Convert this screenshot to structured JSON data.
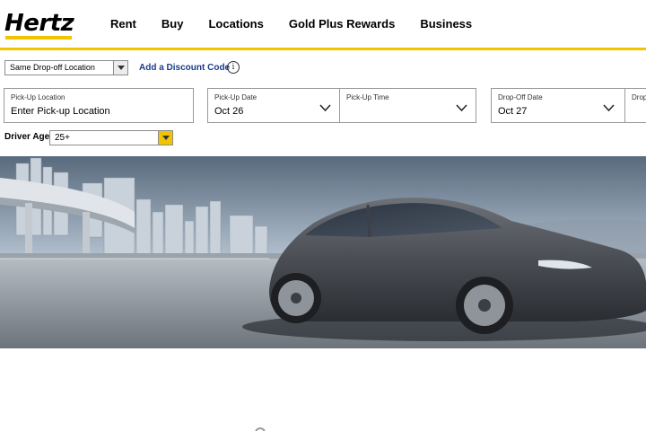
{
  "brand": {
    "logo_text": "Hertz",
    "accent": "#f2c400",
    "link_color": "#1a3c8b"
  },
  "nav": {
    "items": [
      {
        "label": "Rent"
      },
      {
        "label": "Buy"
      },
      {
        "label": "Locations"
      },
      {
        "label": "Gold Plus Rewards"
      },
      {
        "label": "Business"
      }
    ]
  },
  "booking": {
    "dropoff_mode": {
      "selected": "Same Drop-off Location"
    },
    "discount_link": "Add a Discount Code",
    "info_icon": "i",
    "pickup_location": {
      "label": "Pick-Up Location",
      "placeholder": "Enter Pick-up Location"
    },
    "pickup_date": {
      "label": "Pick-Up Date",
      "value": "Oct 26"
    },
    "pickup_time": {
      "label": "Pick-Up Time",
      "value": ""
    },
    "dropoff_date": {
      "label": "Drop-Off Date",
      "value": "Oct 27"
    },
    "dropoff_time": {
      "label": "Drop",
      "value": ""
    },
    "driver_age": {
      "label": "Driver Age",
      "selected": "25+"
    }
  },
  "hero": {
    "image": "car-on-highway-city-skyline"
  }
}
